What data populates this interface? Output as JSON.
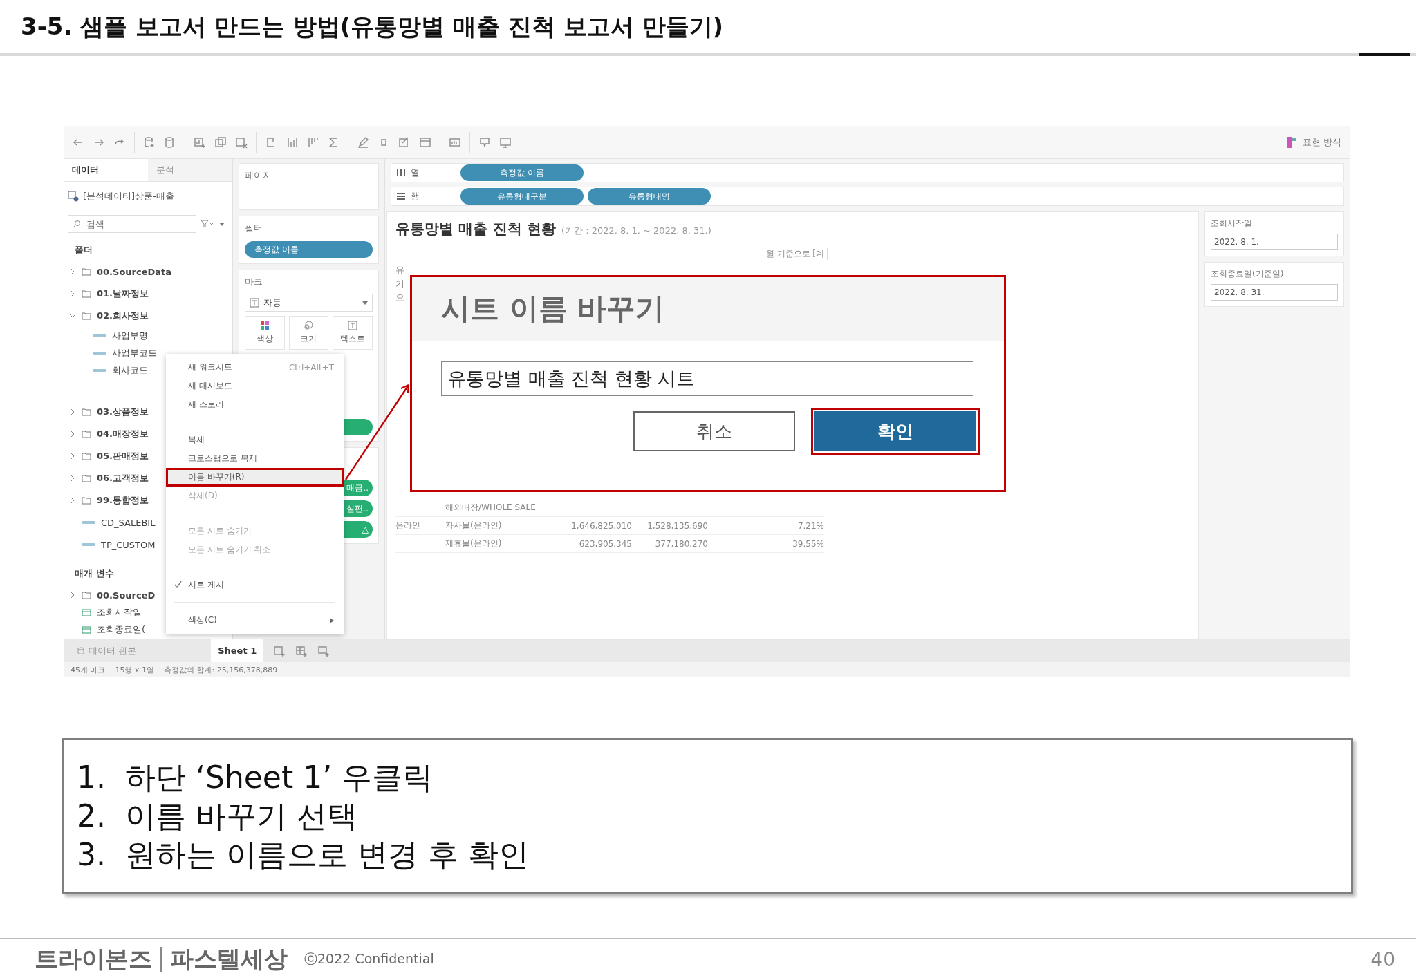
{
  "slide": {
    "title": "3-5. 샘플 보고서 만드는 방법(유통망별 매출 진척 보고서 만들기)"
  },
  "app": {
    "toolbar": {
      "right_label": "표현 방식"
    },
    "data_pane": {
      "tabs": [
        {
          "label": "데이터",
          "selected": true
        },
        {
          "label": "분석",
          "selected": false
        }
      ],
      "datasource": "[분석데이터]상품-매출",
      "search": {
        "placeholder": "검색"
      },
      "folders_heading": "폴더",
      "tree": [
        {
          "label": "00.SourceData",
          "kind": "folder",
          "expanded": false
        },
        {
          "label": "01.날짜정보",
          "kind": "folder",
          "expanded": false
        },
        {
          "label": "02.회사정보",
          "kind": "folder",
          "expanded": true,
          "children": [
            {
              "label": "사업부명",
              "kind": "dimension"
            },
            {
              "label": "사업부코드",
              "kind": "dimension"
            },
            {
              "label": "회사코드",
              "kind": "dimension"
            }
          ]
        },
        {
          "label": "03.상품정보",
          "kind": "folder",
          "expanded": false
        },
        {
          "label": "04.매장정보",
          "kind": "folder",
          "expanded": false
        },
        {
          "label": "05.판매정보",
          "kind": "folder",
          "expanded": false
        },
        {
          "label": "06.고객정보",
          "kind": "folder",
          "expanded": false
        },
        {
          "label": "99.통합정보",
          "kind": "folder",
          "expanded": false
        },
        {
          "label": "CD_SALEBIL",
          "kind": "dimension"
        },
        {
          "label": "TP_CUSTOM",
          "kind": "dimension"
        }
      ],
      "params_heading": "매개 변수",
      "params": [
        {
          "label": "00.SourceD",
          "kind": "folder",
          "expanded": false
        },
        {
          "label": "조회시작일",
          "kind": "date"
        },
        {
          "label": "조회종료일(",
          "kind": "date"
        }
      ]
    },
    "cards": {
      "pages": {
        "title": "페이지"
      },
      "filters": {
        "title": "필터",
        "pills": [
          "측정값 이름"
        ]
      },
      "marks": {
        "title": "마크",
        "mark_type": "자동",
        "buttons": [
          "색상",
          "크기",
          "텍스트"
        ]
      },
      "measure_pills": [
        "매금..",
        "실편..",
        "△"
      ]
    },
    "shelves": [
      {
        "label": "열",
        "pills": [
          "측정값 이름"
        ]
      },
      {
        "label": "행",
        "pills": [
          "유통형태구분",
          "유통형태명"
        ]
      }
    ],
    "view": {
      "title": "유통망별 매출 진척 현황",
      "period": "(기간 : 2022. 8. 1. ~ 2022. 8. 31.)",
      "header_fragment": "월 기준으로 [계",
      "side_fragments": [
        "유",
        "기",
        "오"
      ],
      "rows": [
        {
          "name": "해외매장/WHOLE SALE"
        },
        {
          "group": "온라인",
          "name": "자사몰(온라인)",
          "values": [
            "1,646,825,010",
            "1,528,135,690",
            "7.21%"
          ]
        },
        {
          "name": "제휴몰(온라인)",
          "values": [
            "623,905,345",
            "377,180,270",
            "39.55%"
          ]
        }
      ]
    },
    "parameters_panel": [
      {
        "label": "조회시작일",
        "value": "2022. 8. 1."
      },
      {
        "label": "조회종료일(기준일)",
        "value": "2022. 8. 31."
      }
    ],
    "sheet_tabs": [
      {
        "label": "데이터 원본",
        "kind": "datasource",
        "selected": false
      },
      {
        "label": "Sheet 1",
        "kind": "sheet",
        "selected": true
      }
    ],
    "status_bar": [
      "45개 마크",
      "15행 x 1열",
      "측정값의 합계: 25,156,378,889"
    ],
    "context_menu": [
      {
        "kind": "item",
        "label": "새 워크시트",
        "shortcut": "Ctrl+Alt+T",
        "disabled": false,
        "checked": false,
        "selected": false,
        "submenu": false
      },
      {
        "kind": "item",
        "label": "새 대시보드",
        "disabled": false,
        "checked": false,
        "selected": false,
        "submenu": false
      },
      {
        "kind": "item",
        "label": "새 스토리",
        "disabled": false,
        "checked": false,
        "selected": false,
        "submenu": false
      },
      {
        "kind": "separator"
      },
      {
        "kind": "item",
        "label": "복제",
        "disabled": false,
        "checked": false,
        "selected": false,
        "submenu": false
      },
      {
        "kind": "item",
        "label": "크로스탭으로 복제",
        "disabled": false,
        "checked": false,
        "selected": false,
        "submenu": false
      },
      {
        "kind": "item",
        "label": "이름 바꾸기(R)",
        "disabled": false,
        "checked": false,
        "selected": true,
        "submenu": false
      },
      {
        "kind": "item",
        "label": "삭제(D)",
        "disabled": true,
        "checked": false,
        "selected": false,
        "submenu": false
      },
      {
        "kind": "separator"
      },
      {
        "kind": "item",
        "label": "모든 시트 숨기기",
        "disabled": true,
        "checked": false,
        "selected": false,
        "submenu": false
      },
      {
        "kind": "item",
        "label": "모든 시트 숨기기 취소",
        "disabled": true,
        "checked": false,
        "selected": false,
        "submenu": false
      },
      {
        "kind": "separator"
      },
      {
        "kind": "item",
        "label": "시트 게시",
        "disabled": false,
        "checked": true,
        "selected": false,
        "submenu": false
      },
      {
        "kind": "separator"
      },
      {
        "kind": "item",
        "label": "색상(C)",
        "disabled": false,
        "checked": false,
        "selected": false,
        "submenu": true
      }
    ],
    "dialog": {
      "title": "시트 이름 바꾸기",
      "value": "유통망별 매출 진척 현황 시트",
      "buttons": [
        {
          "label": "취소",
          "kind": "secondary"
        },
        {
          "label": "확인",
          "kind": "primary"
        }
      ]
    }
  },
  "instructions": [
    {
      "number": "1.",
      "text": "하단 ‘Sheet 1’ 우클릭"
    },
    {
      "number": "2.",
      "text": "이름 바꾸기 선택"
    },
    {
      "number": "3.",
      "text": "원하는 이름으로 변경 후 확인"
    }
  ],
  "footer": {
    "logo": [
      "트라이본즈",
      "파스텔세상"
    ],
    "copyright": "ⓒ2022 Confidential",
    "page": "40"
  }
}
